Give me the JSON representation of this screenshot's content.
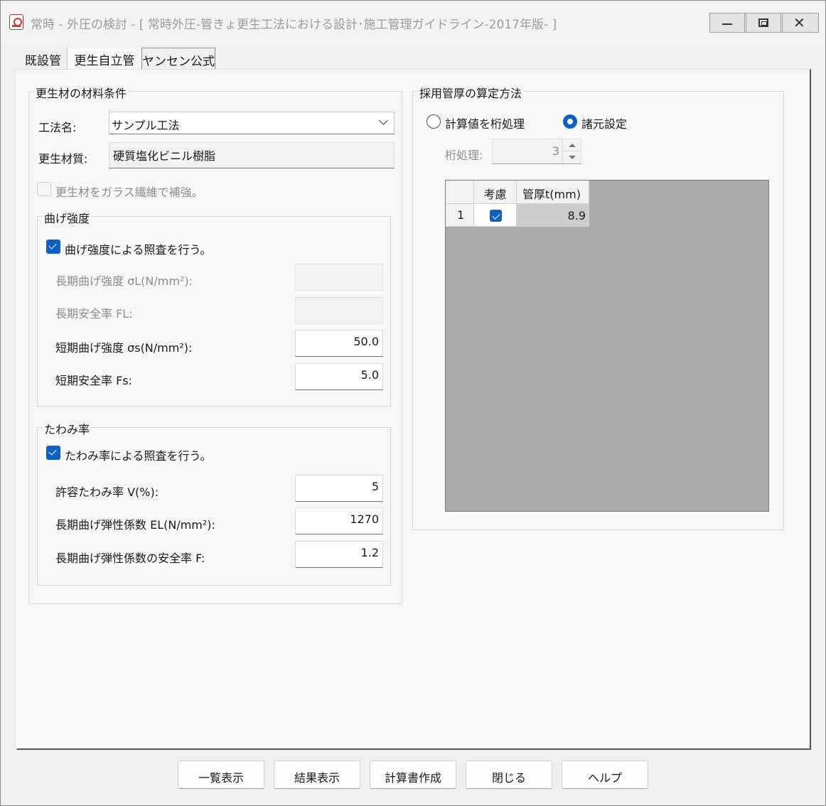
{
  "window": {
    "title": "常時 - 外圧の検討 - [ 常時外圧-管きょ更生工法における設計･施工管理ガイドライン-2017年版- ]",
    "minimize_glyph": "—",
    "close_glyph": "✕"
  },
  "tabs": [
    {
      "label": "既設管"
    },
    {
      "label": "更生自立管"
    },
    {
      "label": "ヤンセン公式"
    }
  ],
  "material": {
    "group_title": "更生材の材料条件",
    "method_label": "工法名:",
    "method_value": "サンプル工法",
    "material_label": "更生材質:",
    "material_value": "硬質塩化ビニル樹脂",
    "glass_label": "更生材をガラス繊維で補強。",
    "glass_checked": false
  },
  "bending": {
    "group_title": "曲げ強度",
    "check_label": "曲げ強度による照査を行う。",
    "check_checked": true,
    "long_strength_label": "長期曲げ強度 σL(N/mm²):",
    "long_strength_value": "",
    "long_safety_label": "長期安全率 FL:",
    "long_safety_value": "",
    "short_strength_label": "短期曲げ強度 σs(N/mm²):",
    "short_strength_value": "50.0",
    "short_safety_label": "短期安全率 Fs:",
    "short_safety_value": "5.0"
  },
  "deflection": {
    "group_title": "たわみ率",
    "check_label": "たわみ率による照査を行う。",
    "check_checked": true,
    "allow_label": "許容たわみ率 V(%):",
    "allow_value": "5",
    "modulus_label": "長期曲げ弾性係数 EL(N/mm²):",
    "modulus_value": "1270",
    "modulus_safety_label": "長期曲げ弾性係数の安全率 F:",
    "modulus_safety_value": "1.2"
  },
  "thickness": {
    "group_title": "採用管厚の算定方法",
    "radio_calc_label": "計算値を桁処理",
    "radio_calc_selected": false,
    "radio_spec_label": "諸元設定",
    "radio_spec_selected": true,
    "digits_label": "桁処理:",
    "digits_value": "3",
    "grid": {
      "headers": [
        "",
        "考慮",
        "管厚t(mm)"
      ],
      "rows": [
        {
          "no": "1",
          "consider": true,
          "thickness": "8.9"
        }
      ]
    }
  },
  "buttons": {
    "list": "一覧表示",
    "result": "結果表示",
    "report": "計算書作成",
    "close": "閉じる",
    "help": "ヘルプ"
  }
}
